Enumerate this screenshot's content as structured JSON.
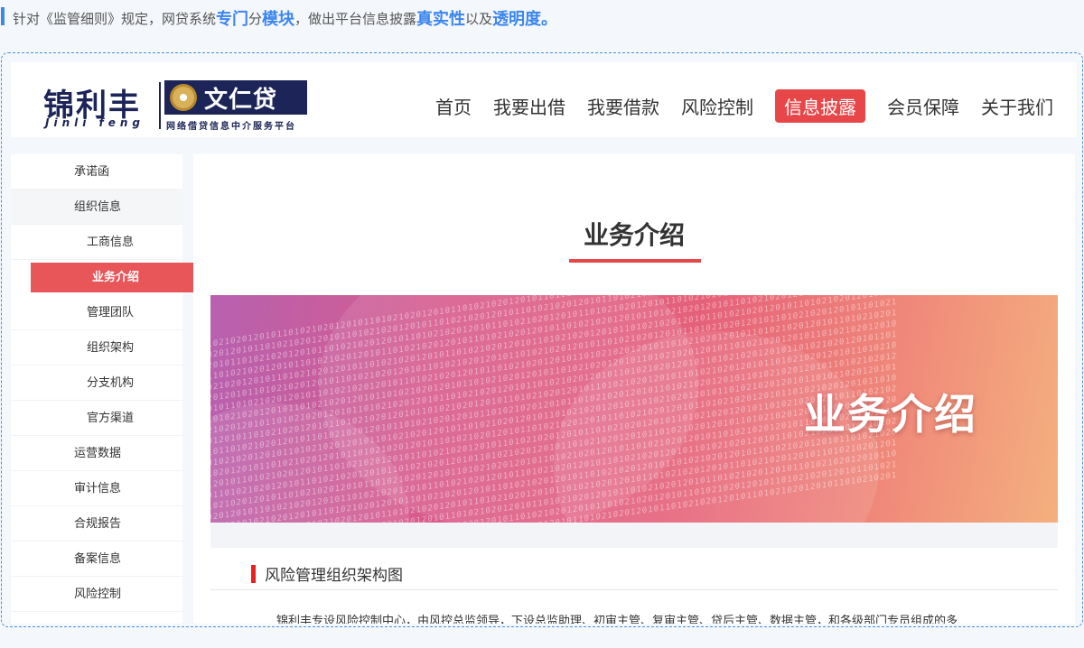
{
  "notice": {
    "p1": "针对《监管细则》规定，网贷系统",
    "h1": "专门",
    "p2": "分",
    "h2": "模块",
    "p3": "，做出平台信息披露",
    "h3": "真实性",
    "p4": "以及",
    "h4": "透明度。"
  },
  "logo": {
    "cn": "锦利丰",
    "en": "Jinli feng",
    "badge": "文仁贷",
    "sub": "网络借贷信息中介服务平台"
  },
  "nav": [
    "首页",
    "我要出借",
    "我要借款",
    "风险控制",
    "信息披露",
    "会员保障",
    "关于我们"
  ],
  "nav_active": "信息披露",
  "sidebar": [
    {
      "label": "承诺函"
    },
    {
      "label": "组织信息"
    },
    {
      "label": "工商信息"
    },
    {
      "label": "业务介绍"
    },
    {
      "label": "管理团队"
    },
    {
      "label": "组织架构"
    },
    {
      "label": "分支机构"
    },
    {
      "label": "官方渠道"
    },
    {
      "label": "运营数据"
    },
    {
      "label": "审计信息"
    },
    {
      "label": "合规报告"
    },
    {
      "label": "备案信息"
    },
    {
      "label": "风险控制"
    }
  ],
  "main": {
    "title": "业务介绍",
    "banner_title": "业务介绍",
    "section_title": "风险管理组织架构图",
    "paragraph": "锦利丰专设风险控制中心，由风控总监领导，下设总监助理、初审主管、复审主管、贷后主管、数据主管，和各级部门专员组成的多"
  },
  "colors": {
    "accent": "#e8474a",
    "link_blue": "#3b86f0",
    "brand_navy": "#1c2458"
  }
}
